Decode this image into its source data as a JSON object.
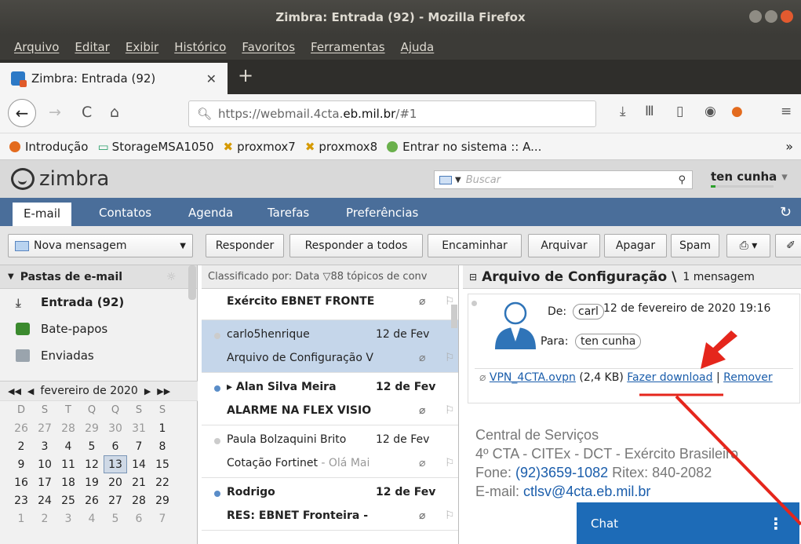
{
  "window": {
    "title": "Zimbra: Entrada (92) - Mozilla Firefox"
  },
  "menubar": [
    "Arquivo",
    "Editar",
    "Exibir",
    "Histórico",
    "Favoritos",
    "Ferramentas",
    "Ajuda"
  ],
  "tab": {
    "label": "Zimbra: Entrada (92)"
  },
  "url": {
    "prefix": "https://webmail.4cta.",
    "host": "eb.mil.br",
    "suffix": "/#1"
  },
  "bookmarks": [
    "Introdução",
    "StorageMSA1050",
    "proxmox7",
    "proxmox8",
    "Entrar no sistema :: A..."
  ],
  "zimbra": {
    "logo": "zimbra",
    "search_placeholder": "Buscar",
    "user": "ten cunha",
    "apps": [
      "E-mail",
      "Contatos",
      "Agenda",
      "Tarefas",
      "Preferências"
    ]
  },
  "toolbar": {
    "new_message": "Nova mensagem",
    "reply": "Responder",
    "reply_all": "Responder a todos",
    "forward": "Encaminhar",
    "archive": "Arquivar",
    "delete": "Apagar",
    "spam": "Spam"
  },
  "folders": {
    "header": "Pastas de e-mail",
    "items": [
      "Entrada (92)",
      "Bate-papos",
      "Enviadas"
    ]
  },
  "calendar": {
    "month": "fevereiro de 2020",
    "dow": [
      "D",
      "S",
      "T",
      "Q",
      "Q",
      "S",
      "S"
    ],
    "days": [
      "26",
      "27",
      "28",
      "29",
      "30",
      "31",
      "1",
      "2",
      "3",
      "4",
      "5",
      "6",
      "7",
      "8",
      "9",
      "10",
      "11",
      "12",
      "13",
      "14",
      "15",
      "16",
      "17",
      "18",
      "19",
      "20",
      "21",
      "22",
      "23",
      "24",
      "25",
      "26",
      "27",
      "28",
      "29",
      "1",
      "2",
      "3",
      "4",
      "5",
      "6",
      "7"
    ]
  },
  "list": {
    "header": "Classificado por: Data ▽88 tópicos de conv",
    "conversations": [
      {
        "from": "",
        "date": "",
        "subject": "Exército EBNET FRONTE",
        "fragment": ""
      },
      {
        "from": "carlo5henrique",
        "date": "12 de Fev",
        "subject": "Arquivo de Configuração V",
        "fragment": ""
      },
      {
        "from": "▸ Alan Silva Meira",
        "date": "12 de Fev",
        "subject": "ALARME NA FLEX VISIO",
        "fragment": ""
      },
      {
        "from": "Paula Bolzaquini Brito",
        "date": "12 de Fev",
        "subject": "Cotação Fortinet",
        "fragment": " - Olá Mai"
      },
      {
        "from": "Rodrigo",
        "date": "12 de Fev",
        "subject": "RES: EBNET Fronteira -",
        "fragment": ""
      }
    ]
  },
  "reading": {
    "subject": "Arquivo de Configuração \\",
    "count": "1 mensagem",
    "from_label": "De:",
    "from": "carl",
    "date": "12 de fevereiro de 2020 19:16",
    "to_label": "Para:",
    "to": "ten cunha",
    "attachment": {
      "name": "VPN_4CTA.ovpn",
      "size": "(2,4 KB)",
      "download": "Fazer download",
      "sep": "|",
      "remove": "Remover"
    },
    "signature": {
      "line1": "Central de Serviços",
      "line2": "4º CTA - CITEx - DCT - Exército Brasileiro",
      "fone_label": "Fone: ",
      "fone": "(92)3659-1082",
      "ritex": " Ritex: 840-2082",
      "email_label": "E-mail: ",
      "email": "ctlsv@4cta.eb.mil.br"
    }
  },
  "chat": {
    "label": "Chat"
  }
}
